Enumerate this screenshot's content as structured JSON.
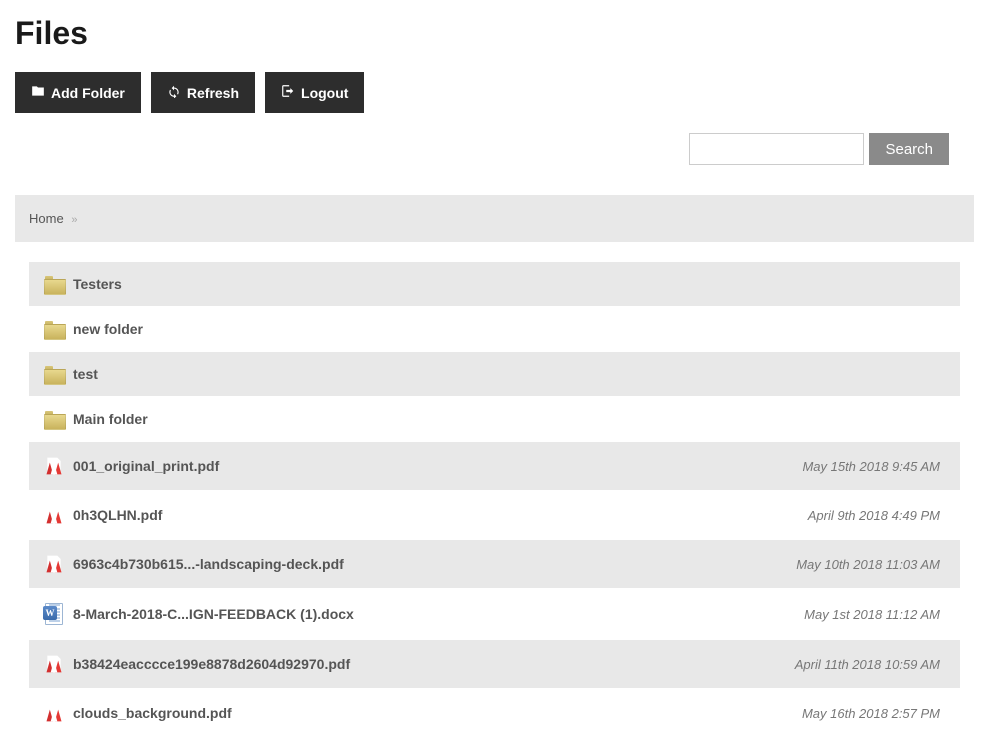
{
  "page_title": "Files",
  "toolbar": {
    "add_folder_label": "Add Folder",
    "refresh_label": "Refresh",
    "logout_label": "Logout"
  },
  "search": {
    "button_label": "Search",
    "value": ""
  },
  "breadcrumb": {
    "home_label": "Home"
  },
  "items": [
    {
      "type": "folder",
      "name": "Testers",
      "date": ""
    },
    {
      "type": "folder",
      "name": "new folder",
      "date": ""
    },
    {
      "type": "folder",
      "name": "test",
      "date": ""
    },
    {
      "type": "folder",
      "name": "Main folder",
      "date": ""
    },
    {
      "type": "pdf",
      "name": "001_original_print.pdf",
      "date": "May 15th 2018 9:45 AM"
    },
    {
      "type": "pdf",
      "name": "0h3QLHN.pdf",
      "date": "April 9th 2018 4:49 PM"
    },
    {
      "type": "pdf",
      "name": "6963c4b730b615...-landscaping-deck.pdf",
      "date": "May 10th 2018 11:03 AM"
    },
    {
      "type": "docx",
      "name": "8-March-2018-C...IGN-FEEDBACK (1).docx",
      "date": "May 1st 2018 11:12 AM"
    },
    {
      "type": "pdf",
      "name": "b38424eacccce199e8878d2604d92970.pdf",
      "date": "April 11th 2018 10:59 AM"
    },
    {
      "type": "pdf",
      "name": "clouds_background.pdf",
      "date": "May 16th 2018 2:57 PM"
    }
  ]
}
